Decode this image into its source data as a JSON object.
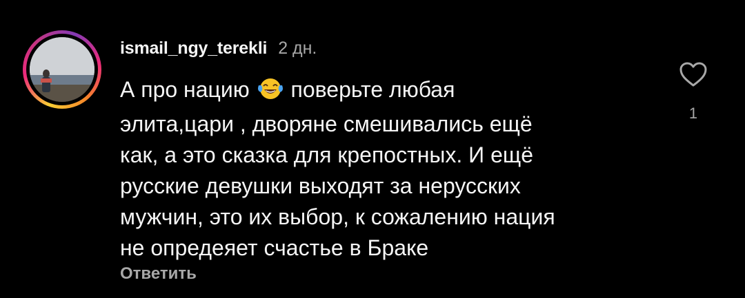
{
  "comment": {
    "username": "ismail_ngy_terekli",
    "time_ago": "2 дн.",
    "lines": [
      {
        "before": "А про нацию ",
        "emoji": "joy-tears",
        "after": " поверьте любая"
      },
      {
        "text": "элита,цари , дворяне смешивались ещё"
      },
      {
        "text": "как, а это сказка для крепостных.  И ещё"
      },
      {
        "text": "русские девушки выходят за нерусских"
      },
      {
        "text": "мужчин, это их  выбор, к сожалению нация"
      },
      {
        "text": "не опредеяет счастье в Браке"
      }
    ],
    "reply_label": "Ответить",
    "like_count": "1"
  },
  "icons": {
    "like": "heart-outline-icon",
    "emoji": "face-with-tears-of-joy-emoji"
  },
  "colors": {
    "background": "#000000",
    "text_primary": "#f5f5f5",
    "text_secondary": "#a8a8a8",
    "story_ring": [
      "#f9ce34",
      "#ee2a7b",
      "#833ab4"
    ]
  }
}
